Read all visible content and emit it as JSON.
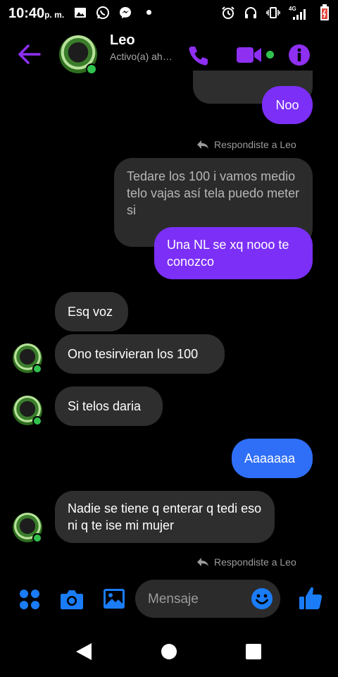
{
  "status_bar": {
    "time": "10:40",
    "ampm": "p. m.",
    "network_label": "4G"
  },
  "header": {
    "contact_name": "Leo",
    "contact_status": "Activo(a) ahora"
  },
  "messages": {
    "top_partial": "Noo",
    "reply_note_1": "Respondiste a Leo",
    "quoted_text": "Tedare los 100 i vamos medio telo vajas así tela puedo meter si",
    "sent_1": "Una NL se xq nooo te conozco",
    "recv_1": "Esq voz",
    "recv_2": "Ono tesirvieran los 100",
    "recv_3": "Si telos daria",
    "sent_2": "Aaaaaaa",
    "recv_4": "Nadie se tiene q enterar q tedi eso ni q te ise mi mujer",
    "reply_note_2": "Respondiste a Leo"
  },
  "composer": {
    "placeholder": "Mensaje"
  },
  "colors": {
    "accent": "#8e2ff2",
    "sent_bubble": "#7b2ff7",
    "sent_blue": "#2f6ff7",
    "received_bubble": "#2e2e2e",
    "composer_icon": "#1a7cf7",
    "online": "#31c24d"
  },
  "icons": {
    "back": "arrow-left-icon",
    "call": "phone-icon",
    "video": "video-camera-icon",
    "info": "info-icon",
    "apps": "four-dots-icon",
    "camera": "camera-icon",
    "gallery": "image-icon",
    "emoji": "smiley-icon",
    "like": "thumbs-up-icon"
  }
}
